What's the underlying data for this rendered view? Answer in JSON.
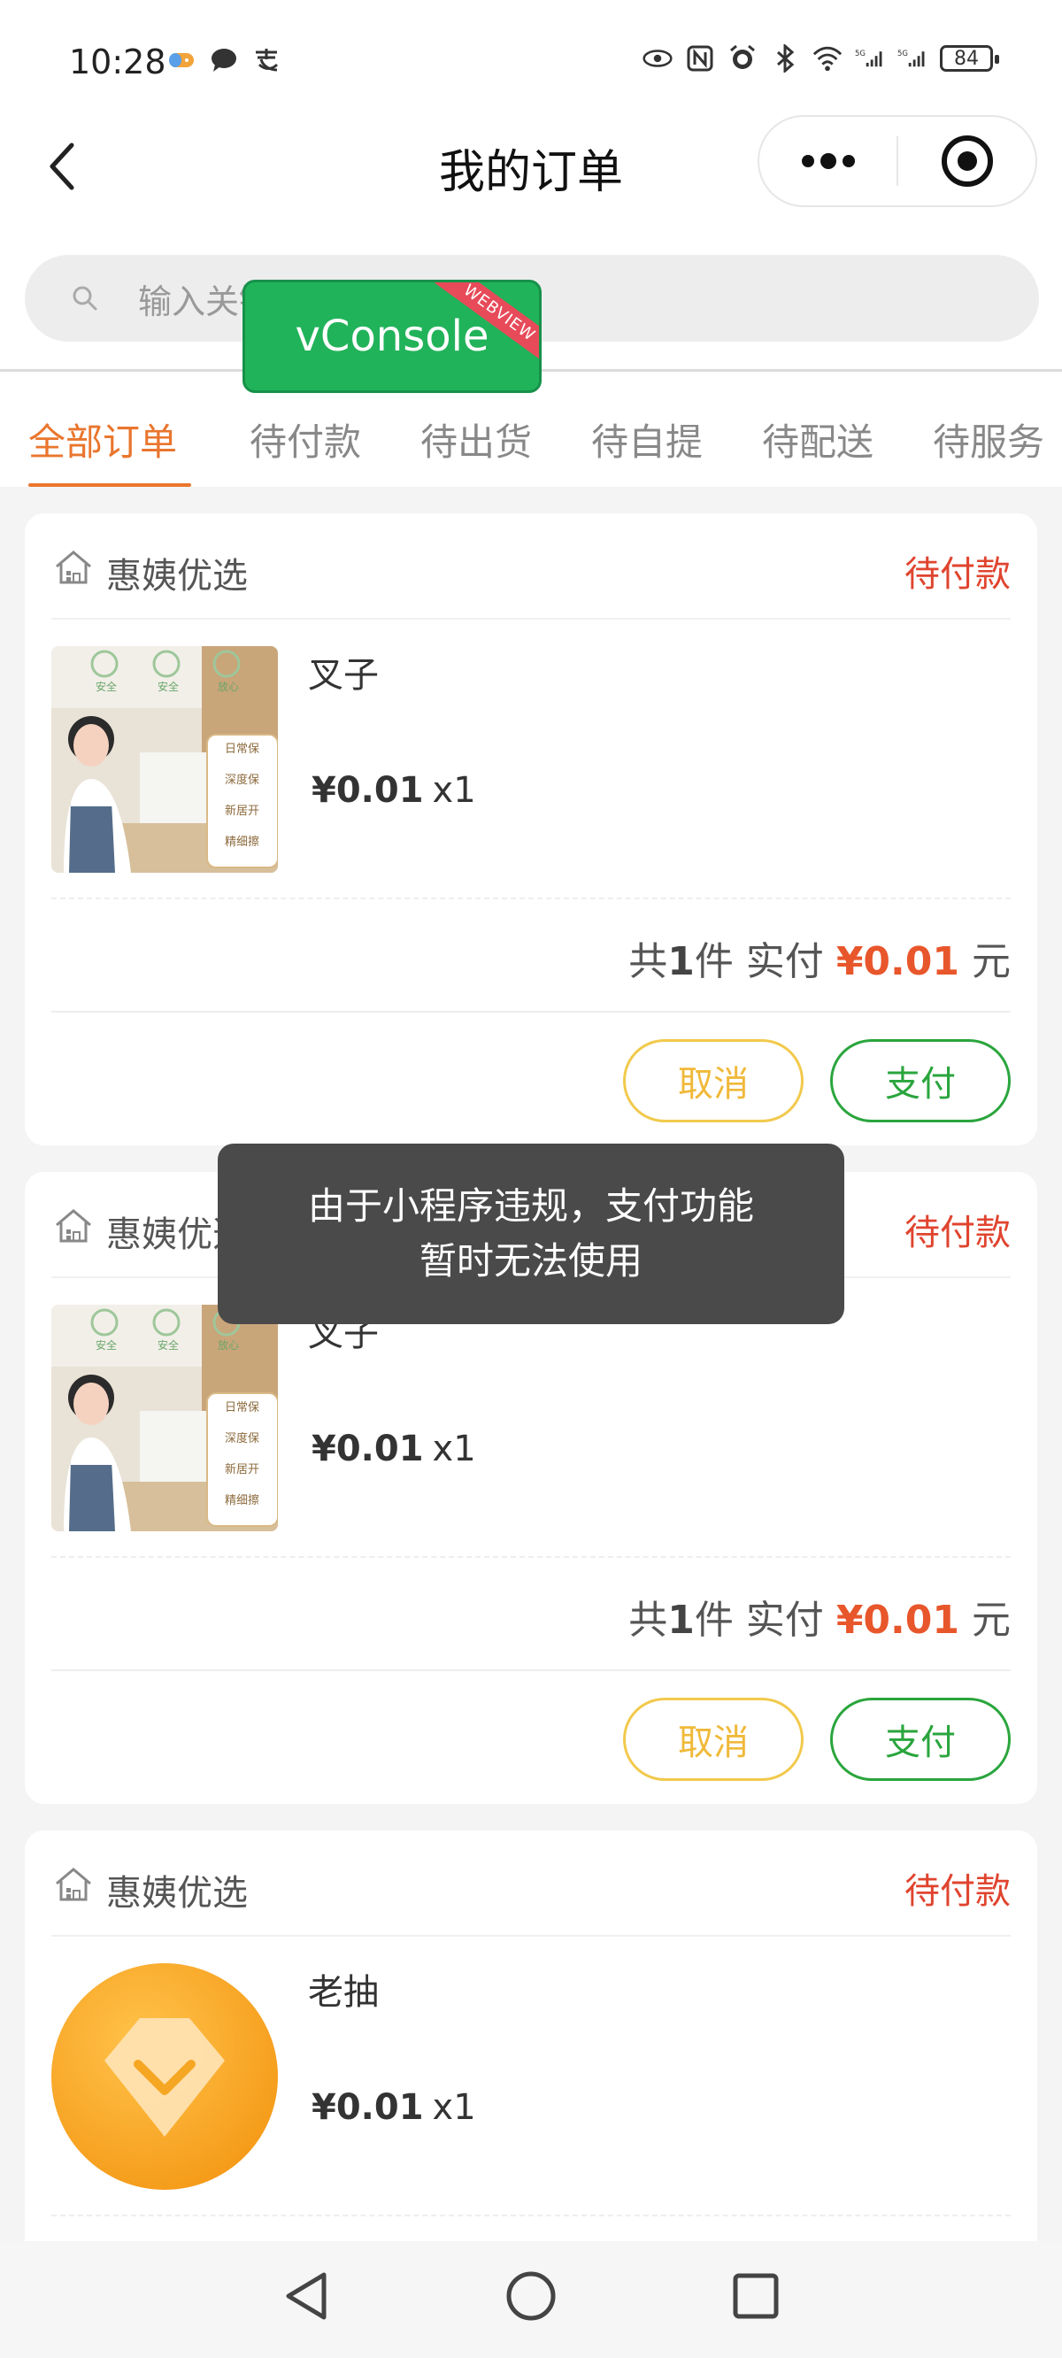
{
  "status_bar": {
    "time": "10:28",
    "left_icons": [
      "game-icon",
      "chat-bubble-icon",
      "alipay-icon"
    ],
    "right_icons": [
      "eye-icon",
      "nfc-icon",
      "alarm-icon",
      "bluetooth-icon",
      "wifi-icon",
      "signal-5g-icon",
      "signal-5g-icon"
    ],
    "battery": "84"
  },
  "nav": {
    "title": "我的订单"
  },
  "search": {
    "placeholder": "输入关键"
  },
  "vconsole": {
    "label": "vConsole",
    "ribbon": "WEBVIEW"
  },
  "tabs": [
    {
      "label": "全部订单",
      "active": true
    },
    {
      "label": "待付款"
    },
    {
      "label": "待出货"
    },
    {
      "label": "待自提"
    },
    {
      "label": "待配送"
    },
    {
      "label": "待服务"
    }
  ],
  "orders": [
    {
      "shop": "惠姨优选",
      "status": "待付款",
      "thumb_badges": [
        "安全",
        "安全",
        "放心"
      ],
      "thumb_tags": [
        "日常保",
        "深度保",
        "新居开",
        "精细擦"
      ],
      "item_name": "叉子",
      "price": "¥0.01",
      "qty": "x1",
      "summary_prefix": "共",
      "count": "1",
      "summary_mid": "件 实付",
      "paid": "¥0.01",
      "unit": "元",
      "cancel_label": "取消",
      "pay_label": "支付"
    },
    {
      "shop": "惠姨优选",
      "status": "待付款",
      "thumb_badges": [
        "安全",
        "安全",
        "放心"
      ],
      "thumb_tags": [
        "日常保",
        "深度保",
        "新居开",
        "精细擦"
      ],
      "item_name": "叉子",
      "price": "¥0.01",
      "qty": "x1",
      "summary_prefix": "共",
      "count": "1",
      "summary_mid": "件 实付",
      "paid": "¥0.01",
      "unit": "元",
      "cancel_label": "取消",
      "pay_label": "支付"
    },
    {
      "shop": "惠姨优选",
      "status": "待付款",
      "item_name": "老抽",
      "price": "¥0.01",
      "qty": "x1"
    }
  ],
  "toast": {
    "line1": "由于小程序违规，支付功能",
    "line2": "暂时无法使用"
  },
  "colors": {
    "accent": "#e9762e",
    "status_red": "#e0442f",
    "pay_green": "#2aa53d",
    "cancel_yellow": "#f2c94c",
    "price_orange": "#e8562b",
    "vconsole_green": "#21b35a"
  }
}
